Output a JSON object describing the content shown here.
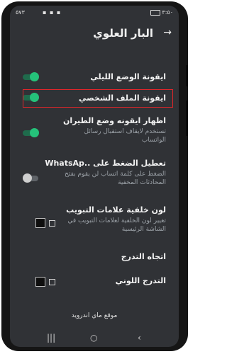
{
  "status": {
    "time": "٣:٥٠",
    "signal": "٥٧٣"
  },
  "header": {
    "title": "البار العلوي",
    "back_icon": "arrow-right-icon"
  },
  "rows": [
    {
      "label": "ايقونة الوضع الليلي",
      "desc": "",
      "control": "toggle",
      "state": "on"
    },
    {
      "label": "ايقونة الملف الشخصي",
      "desc": "",
      "control": "toggle",
      "state": "on",
      "highlighted": true
    },
    {
      "label": "اظهار ايقونه وضع الطيران",
      "desc": "تستخدم لايقاف استقبال رسائل الواتساب",
      "control": "toggle",
      "state": "on"
    },
    {
      "label": "تعطيل الضغط على ..WhatsAp",
      "desc": "الضغط على كلمة اتساب لن يقوم بفتح المحادثات المخفية",
      "control": "toggle",
      "state": "off"
    },
    {
      "label": "لون خلفية علامات التبويب",
      "desc": "تغيير لون الخلفية لعلامات التبويب في الشاشة الرئيسية",
      "control": "color",
      "color": "#0e0e0e"
    },
    {
      "label": "اتجاه التدرج",
      "desc": "",
      "control": "none"
    },
    {
      "label": "التدرج اللوني",
      "desc": "",
      "control": "color",
      "color": "#0e0e0e"
    }
  ],
  "footer": {
    "text": "موقع ماي اندرويد"
  },
  "nav": {
    "recent": "|||",
    "home": "○",
    "back": "‹"
  },
  "colors": {
    "accent": "#25c27a",
    "highlight": "#e0262b",
    "background": "#303236"
  }
}
